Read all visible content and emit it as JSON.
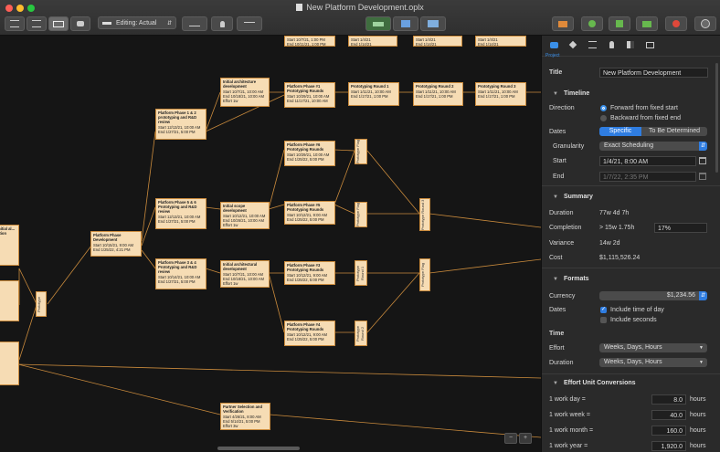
{
  "window": {
    "title": "New Platform Development.oplx"
  },
  "toolbar": {
    "editing_label": "Editing: Actual"
  },
  "canvas": {
    "nodes": {
      "root_partial": {
        "title": "Prototype"
      },
      "left_a": {
        "title": "Initial al... ation"
      },
      "phase_dev": {
        "title": "Platform Phase Development",
        "start": "Start 10/15/21, 9:00 AM",
        "end": "End 1/25/22, 4:21 PM"
      },
      "pp12": {
        "title": "Platform Phase 1 & 2 prototyping and R&D review",
        "start": "Start 12/13/21, 10:00 AM",
        "end": "End 1/27/21, 5:00 PM"
      },
      "pp56": {
        "title": "Platform Phase 5 & 6 Prototyping and R&D review",
        "start": "Start 12/13/21, 10:00 AM",
        "end": "End 1/27/21, 5:00 PM"
      },
      "pp34": {
        "title": "Platform Phase 3 & 4 Prototyping and R&D review",
        "start": "Start 10/14/21, 10:00 AM",
        "end": "End 1/27/21, 5:00 PM"
      },
      "arch1": {
        "title": "Initial architecture development",
        "start": "Start 10/7/21, 10:00 AM",
        "end": "End 10/18/21, 10:00 AM",
        "effort": "Effort 1w"
      },
      "scope": {
        "title": "Initial scope development",
        "start": "Start 10/12/21, 10:00 AM",
        "end": "End 10/26/21, 10:00 AM",
        "effort": "Effort 1w"
      },
      "arch2": {
        "title": "Initial architectural development",
        "start": "Start 10/7/21, 10:00 AM",
        "end": "End 10/18/21, 10:00 AM",
        "effort": "Effort 1w"
      },
      "round1": {
        "title": "Prototyping Round 1",
        "start": "Start 1/11/21, 10:00 AM",
        "end": "End 1/17/21, 1:00 PM"
      },
      "round2": {
        "title": "Prototyping Round 2",
        "start": "Start 1/11/21, 10:00 AM",
        "end": "End 1/17/21, 1:00 PM"
      },
      "round3": {
        "title": "Prototyping Round 3",
        "start": "Start 1/11/21, 10:00 AM",
        "end": "End 1/17/21, 1:00 PM"
      },
      "ph1": {
        "title": "Platform Phase #1 Prototyping Rounds",
        "start": "Start 10/29/21, 10:00 AM",
        "end": "End 11/17/21, 10:00 AM"
      },
      "ph6": {
        "title": "Platform Phase #6 Prototyping Rounds",
        "start": "Start 10/29/21, 10:00 AM",
        "end": "End 1/25/22, 5:00 PM"
      },
      "ph5": {
        "title": "Platform Phase #5 Prototyping Rounds",
        "start": "Start 10/12/21, 9:00 AM",
        "end": "End 1/25/22, 5:00 PM"
      },
      "ph3": {
        "title": "Platform Phase #3 Prototyping Rounds",
        "start": "Start 10/12/21, 9:00 AM",
        "end": "End 1/25/22, 5:00 PM"
      },
      "ph4": {
        "title": "Platform Phase #4 Prototyping Rounds",
        "start": "Start 10/12/21, 9:00 AM",
        "end": "End 1/25/22, 5:00 PM"
      },
      "top1": {
        "start": "Start 10/7/21, 1:00 PM",
        "end": "End 10/11/21, 1:00 PM"
      },
      "top2": {
        "start": "Start 1/4/21",
        "end": "End 1/14/21"
      },
      "top3": {
        "start": "Start 1/4/21",
        "end": "End 1/14/21"
      },
      "top4": {
        "start": "Start 1/4/21",
        "end": "End 1/14/21"
      },
      "top5": {
        "start": "Start 1/4/21",
        "end": "End 1/14/21"
      },
      "partner": {
        "title": "Partner Selection and Verification",
        "start": "Start 4/26/21, 8:00 AM",
        "end": "End 5/14/21, 5:00 PM",
        "effort": "Effort 3w"
      },
      "ms1": {
        "title": "Prototype Flag"
      },
      "ms2": {
        "title": "Prototype Flag"
      },
      "ms3": {
        "title": "Prototype Round 1"
      },
      "ms4": {
        "title": "Prototype Round 2"
      },
      "ms5": {
        "title": "Prototype Round 3"
      },
      "ms6": {
        "title": "Prototype Flag"
      }
    }
  },
  "inspector": {
    "tab_label": "Project",
    "title_label": "Title",
    "title_value": "New Platform Development",
    "timeline": {
      "header": "Timeline",
      "direction_label": "Direction",
      "direction_options": [
        "Forward from fixed start",
        "Backward from fixed end"
      ],
      "dates_label": "Dates",
      "dates_segments": [
        "Specific",
        "To Be Determined"
      ],
      "granularity_label": "Granularity",
      "granularity_value": "Exact Scheduling",
      "start_label": "Start",
      "start_value": "1/4/21, 8:00 AM",
      "end_label": "End",
      "end_value": "1/7/22, 2:35 PM"
    },
    "summary": {
      "header": "Summary",
      "duration_label": "Duration",
      "duration_value": "77w 4d 7h",
      "completion_label": "Completion",
      "completion_value": "> 15w 1.75h",
      "completion_pct": "17%",
      "variance_label": "Variance",
      "variance_value": "14w 2d",
      "cost_label": "Cost",
      "cost_value": "$1,115,526.24"
    },
    "formats": {
      "header": "Formats",
      "currency_label": "Currency",
      "currency_value": "$1,234.56",
      "dates_label": "Dates",
      "include_time": "Include time of day",
      "include_seconds": "Include seconds",
      "time_label": "Time",
      "effort_label": "Effort",
      "effort_value": "Weeks, Days, Hours",
      "duration_label": "Duration",
      "duration_value": "Weeks, Days, Hours"
    },
    "effort_units": {
      "header": "Effort Unit Conversions",
      "rows": [
        {
          "label": "1 work day =",
          "value": "8.0",
          "unit": "hours"
        },
        {
          "label": "1 work week =",
          "value": "40.0",
          "unit": "hours"
        },
        {
          "label": "1 work month =",
          "value": "160.0",
          "unit": "hours"
        },
        {
          "label": "1 work year =",
          "value": "1,920.0",
          "unit": "hours"
        }
      ]
    }
  }
}
